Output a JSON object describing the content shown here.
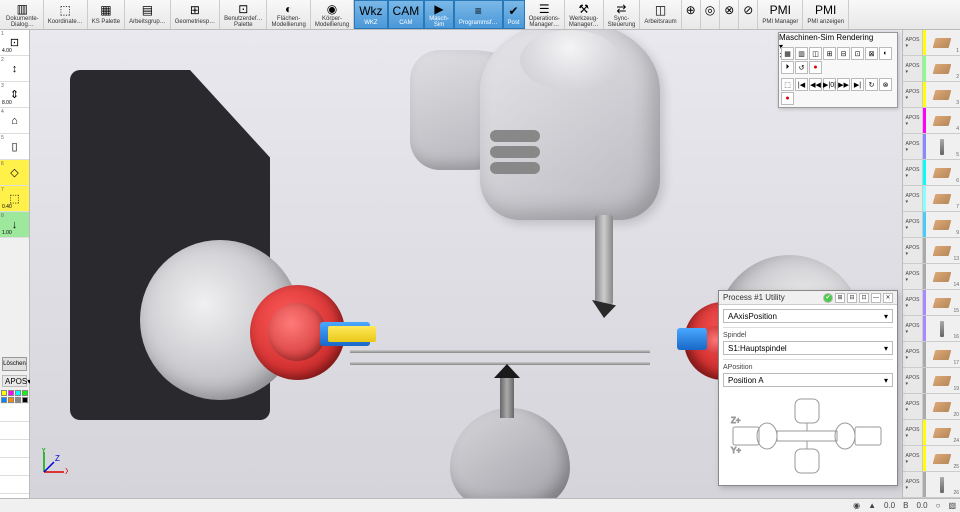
{
  "ribbon": [
    {
      "label": "Dokumente-\nDialog…",
      "icon": "▥"
    },
    {
      "label": "Koordinate…",
      "icon": "⬚"
    },
    {
      "label": "KS Palette",
      "icon": "▦"
    },
    {
      "label": "Arbeitsgrup…",
      "icon": "▤"
    },
    {
      "label": "Geometriesp…",
      "icon": "⊞"
    },
    {
      "label": "Benutzerdef…\nPalette",
      "icon": "⊡"
    },
    {
      "label": "Flächen-\nModellierung",
      "icon": "◐"
    },
    {
      "label": "Körper-\nModellierung",
      "icon": "◉"
    },
    {
      "label": "WKZ",
      "icon": "Wkz",
      "active": true
    },
    {
      "label": "CAM",
      "icon": "CAM",
      "active": true
    },
    {
      "label": "Masch-\nSim",
      "icon": "▶",
      "active": true
    },
    {
      "label": "Programmsf…",
      "icon": "≡",
      "active": true
    },
    {
      "label": "Post",
      "icon": "✔",
      "active": true
    },
    {
      "label": "Operations-\nManager…",
      "icon": "☰"
    },
    {
      "label": "Werkzeug-\nManager…",
      "icon": "⚒"
    },
    {
      "label": "Sync-\nSteuerung",
      "icon": "⇄"
    },
    {
      "label": "Arbeitsraum",
      "icon": "◫"
    },
    {
      "label": "",
      "icon": "⊕"
    },
    {
      "label": "",
      "icon": "◎"
    },
    {
      "label": "",
      "icon": "⊗"
    },
    {
      "label": "",
      "icon": "⊘"
    },
    {
      "label": "PMI Manager",
      "icon": "PMI"
    },
    {
      "label": "PMI anzeigen",
      "icon": "PMI"
    }
  ],
  "left_tools": [
    {
      "n": "1",
      "icon": "⊡",
      "val": "4.00"
    },
    {
      "n": "2",
      "icon": "↕"
    },
    {
      "n": "3",
      "icon": "⇕",
      "val": "8.00"
    },
    {
      "n": "4",
      "icon": "⌂"
    },
    {
      "n": "5",
      "icon": "▯"
    },
    {
      "n": "6",
      "icon": "◇",
      "cls": "yellow"
    },
    {
      "n": "7",
      "icon": "⬚",
      "val": "0.40",
      "cls": "yellow"
    },
    {
      "n": "8",
      "icon": "↓",
      "val": "1.00",
      "cls": "green"
    }
  ],
  "loeschen": "Löschen",
  "apos_left": "APOS",
  "left_colors": [
    "#ff0",
    "#f0f",
    "#0ff",
    "#0f0",
    "#08f",
    "#f80",
    "#888",
    "#000"
  ],
  "right_tools": [
    {
      "c": "#ff0",
      "t": "insert",
      "n": "1"
    },
    {
      "c": "#8f8",
      "t": "insert",
      "n": "2"
    },
    {
      "c": "#ff0",
      "t": "insert",
      "n": "3"
    },
    {
      "c": "#f0f",
      "t": "insert",
      "n": "4"
    },
    {
      "c": "#88f",
      "t": "drill",
      "n": "5"
    },
    {
      "c": "#0ff",
      "t": "insert",
      "n": "6"
    },
    {
      "c": "#8ff",
      "t": "insert",
      "n": "7"
    },
    {
      "c": "#4cf",
      "t": "insert",
      "n": "9"
    },
    {
      "c": "#aaa",
      "t": "insert",
      "n": "13"
    },
    {
      "c": "#aaa",
      "t": "insert",
      "n": "14"
    },
    {
      "c": "#a8f",
      "t": "insert",
      "n": "15"
    },
    {
      "c": "#a8f",
      "t": "drill",
      "n": "16"
    },
    {
      "c": "#aaa",
      "t": "insert",
      "n": "17"
    },
    {
      "c": "#aaa",
      "t": "insert",
      "n": "19"
    },
    {
      "c": "#aaa",
      "t": "insert",
      "n": "20"
    },
    {
      "c": "#ff0",
      "t": "insert",
      "n": "24"
    },
    {
      "c": "#ff0",
      "t": "insert",
      "n": "25"
    },
    {
      "c": "#aaa",
      "t": "drill",
      "n": "26"
    }
  ],
  "apos_right": "APOS",
  "sim": {
    "title": "Maschinen-Sim Rendering",
    "row1": [
      "▦",
      "▥",
      "◫",
      "⊞",
      "⊟",
      "⊡",
      "⊠",
      "◐",
      "⏵",
      "↺",
      "●"
    ],
    "row2": [
      "⬚",
      "|◀",
      "◀◀",
      "▶|0|",
      "▶▶",
      "▶|",
      "↻",
      "⊗",
      "●"
    ]
  },
  "util": {
    "title": "Process #1 Utility",
    "field1": "AAxisPosition",
    "spindel_label": "Spindel",
    "spindel_value": "S1:Hauptspindel",
    "apos_label": "APosition",
    "apos_value": "Position A"
  },
  "status": {
    "sel": "—",
    "mm": "0.0",
    "b": "B",
    "val": "0.0",
    "tri": "▲",
    "circ": "○",
    "eye": "◉",
    "cube": "▧"
  },
  "minitb1": [
    "↶",
    "↷",
    "⊞",
    "☰",
    "⊡",
    "▢",
    "⊟",
    "⊠",
    "◫",
    "▥",
    "▤",
    "◪",
    "◩",
    "⊕",
    "⊖"
  ],
  "axes": {
    "x": "X",
    "y": "Y",
    "z": "Z"
  }
}
